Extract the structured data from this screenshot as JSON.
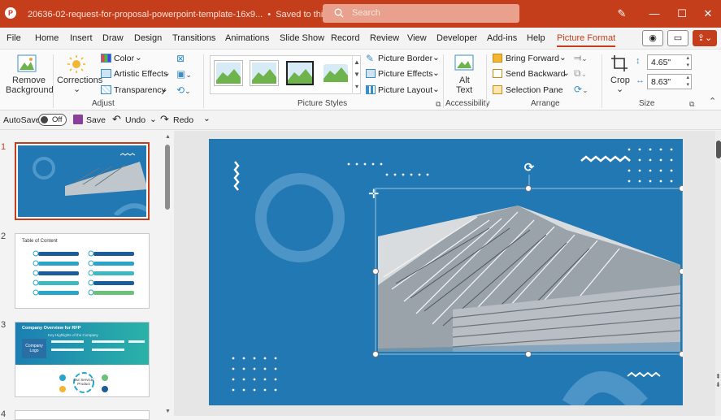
{
  "titlebar": {
    "file_name": "20636-02-request-for-proposal-powerpoint-template-16x9...",
    "save_status": "Saved to this PC",
    "search_placeholder": "Search",
    "accent_color": "#c43e1c"
  },
  "menu": {
    "items": [
      "File",
      "Home",
      "Insert",
      "Draw",
      "Design",
      "Transitions",
      "Animations",
      "Slide Show",
      "Record",
      "Review",
      "View",
      "Developer",
      "Add-ins",
      "Help",
      "Picture Format"
    ],
    "active": "Picture Format"
  },
  "ribbon": {
    "adjust": {
      "remove_background": [
        "Remove",
        "Background"
      ],
      "corrections": "Corrections",
      "color": "Color",
      "artistic_effects": "Artistic Effects",
      "transparency": "Transparency",
      "group_label": "Adjust"
    },
    "picture_styles": {
      "border": "Picture Border",
      "effects": "Picture Effects",
      "layout": "Picture Layout",
      "group_label": "Picture Styles"
    },
    "accessibility": {
      "alt_text": [
        "Alt",
        "Text"
      ],
      "group_label": "Accessibility"
    },
    "arrange": {
      "bring_forward": "Bring Forward",
      "send_backward": "Send Backward",
      "selection_pane": "Selection Pane",
      "group_label": "Arrange"
    },
    "size": {
      "crop": "Crop",
      "height": "4.65\"",
      "width": "8.63\"",
      "group_label": "Size"
    }
  },
  "qat": {
    "autosave": "AutoSave",
    "autosave_state": "Off",
    "save": "Save",
    "undo": "Undo",
    "redo": "Redo"
  },
  "thumbnails": [
    {
      "number": "1"
    },
    {
      "number": "2",
      "title": "Table of Content"
    },
    {
      "number": "3",
      "title": "Company Overview for RFP",
      "subtitle": "Key Highlights of the Company",
      "logo_text": [
        "Company",
        "Logo"
      ],
      "center_text": [
        "Our Service/",
        "Product"
      ]
    },
    {
      "number": "4"
    }
  ],
  "colors": {
    "slide_bg": "#2178b3",
    "menu_bg": "#f3f3f3"
  }
}
